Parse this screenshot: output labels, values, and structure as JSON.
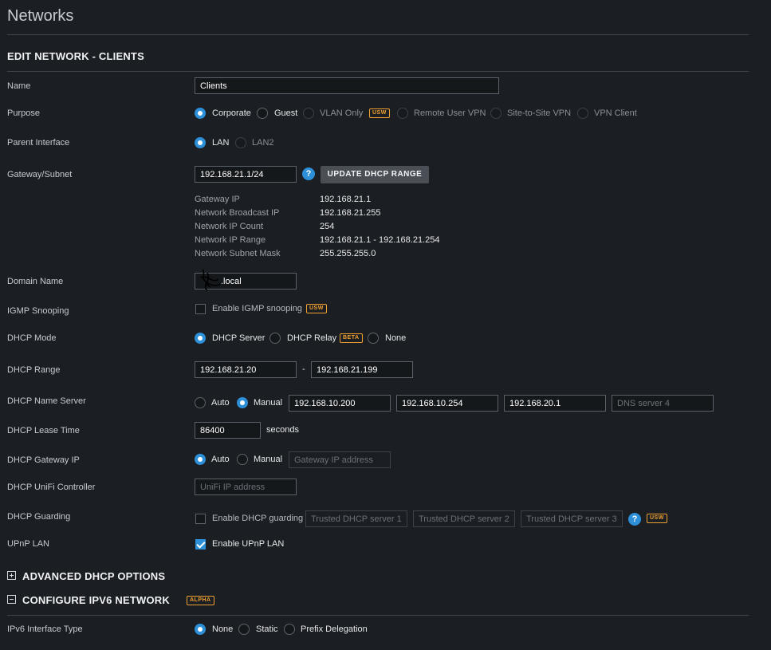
{
  "page_title": "Networks",
  "section_title": "EDIT NETWORK - CLIENTS",
  "labels": {
    "name": "Name",
    "purpose": "Purpose",
    "parent_interface": "Parent Interface",
    "gateway_subnet": "Gateway/Subnet",
    "domain_name": "Domain Name",
    "igmp_snooping": "IGMP Snooping",
    "dhcp_mode": "DHCP Mode",
    "dhcp_range": "DHCP Range",
    "dhcp_name_server": "DHCP Name Server",
    "dhcp_lease_time": "DHCP Lease Time",
    "dhcp_gateway_ip": "DHCP Gateway IP",
    "dhcp_unifi_controller": "DHCP UniFi Controller",
    "dhcp_guarding": "DHCP Guarding",
    "upnp_lan": "UPnP LAN",
    "ipv6_interface_type": "IPv6 Interface Type"
  },
  "name_value": "Clients",
  "purpose_options": {
    "corporate": "Corporate",
    "guest": "Guest",
    "vlan_only": "VLAN Only",
    "remote_user_vpn": "Remote User VPN",
    "site_to_site_vpn": "Site-to-Site VPN",
    "vpn_client": "VPN Client"
  },
  "parent_options": {
    "lan": "LAN",
    "lan2": "LAN2"
  },
  "gateway_subnet_value": "192.168.21.1/24",
  "update_dhcp_range_label": "UPDATE DHCP RANGE",
  "help_glyph": "?",
  "subnet_info": {
    "gateway_ip_label": "Gateway IP",
    "gateway_ip": "192.168.21.1",
    "broadcast_label": "Network Broadcast IP",
    "broadcast": "192.168.21.255",
    "count_label": "Network IP Count",
    "count": "254",
    "range_label": "Network IP Range",
    "range": "192.168.21.1 - 192.168.21.254",
    "mask_label": "Network Subnet Mask",
    "mask": "255.255.255.0"
  },
  "domain_name_value": ".local",
  "igmp_label": "Enable IGMP snooping",
  "dhcp_mode_options": {
    "server": "DHCP Server",
    "relay": "DHCP Relay",
    "none": "None"
  },
  "dhcp_range_start": "192.168.21.20",
  "dhcp_range_sep": "-",
  "dhcp_range_end": "192.168.21.199",
  "name_server_options": {
    "auto": "Auto",
    "manual": "Manual"
  },
  "dns_servers": [
    "192.168.10.200",
    "192.168.10.254",
    "192.168.20.1"
  ],
  "dns4_placeholder": "DNS server 4",
  "lease_time_value": "86400",
  "lease_time_unit": "seconds",
  "gateway_ip_options": {
    "auto": "Auto",
    "manual": "Manual"
  },
  "gateway_ip_placeholder": "Gateway IP address",
  "unifi_ip_placeholder": "UniFi IP address",
  "dhcp_guarding_label": "Enable DHCP guarding",
  "trusted_placeholders": [
    "Trusted DHCP server 1",
    "Trusted DHCP server 2",
    "Trusted DHCP server 3"
  ],
  "upnp_label": "Enable UPnP LAN",
  "advanced_dhcp_title": "ADVANCED DHCP OPTIONS",
  "ipv6_title": "CONFIGURE IPV6 NETWORK",
  "ipv6_options": {
    "none": "None",
    "static": "Static",
    "prefix": "Prefix Delegation"
  },
  "badges": {
    "usw": "USW",
    "beta": "BETA",
    "alpha": "ALPHA"
  },
  "colors": {
    "accent": "#2c8fd8",
    "badge": "#f0a030",
    "background": "#1b1e22"
  }
}
